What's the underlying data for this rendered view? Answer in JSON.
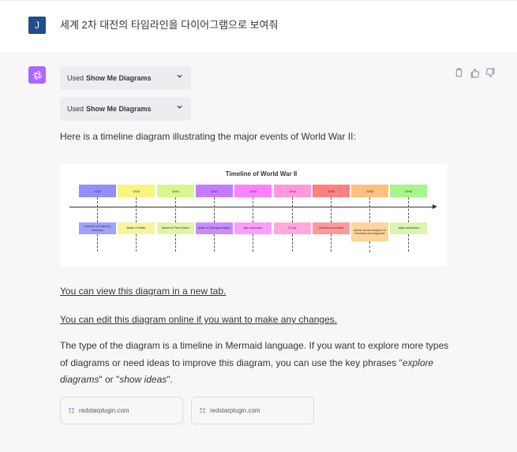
{
  "user": {
    "avatar_letter": "J",
    "message": "세계 2차 대전의 타임라인을 다이어그램으로 보여줘"
  },
  "plugins": [
    {
      "prefix": "Used",
      "name": "Show Me Diagrams"
    },
    {
      "prefix": "Used",
      "name": "Show Me Diagrams"
    }
  ],
  "intro": "Here is a timeline diagram illustrating the major events of World War II:",
  "diagram": {
    "title": "Timeline of World War II",
    "years": [
      {
        "label": "1939",
        "color": "#8f8fff"
      },
      {
        "label": "1940",
        "color": "#f5f580"
      },
      {
        "label": "1941",
        "color": "#d9f58c"
      },
      {
        "label": "1942",
        "color": "#c57bff"
      },
      {
        "label": "1943",
        "color": "#fc80ff"
      },
      {
        "label": "1944",
        "color": "#ff99d9"
      },
      {
        "label": "1945",
        "color": "#ff8080"
      },
      {
        "label": "1945",
        "color": "#ffc07f"
      },
      {
        "label": "1945",
        "color": "#a8f58c"
      }
    ],
    "events": [
      {
        "label": "Invasion of Poland by Germany",
        "color": "#a0a0ff"
      },
      {
        "label": "Battle of Britain",
        "color": "#f5f5a0"
      },
      {
        "label": "Attack on Pearl Harbor",
        "color": "#e1f5a8"
      },
      {
        "label": "Battle of Stalingrad begins",
        "color": "#c98cff"
      },
      {
        "label": "Italy surrenders",
        "color": "#fc9cff"
      },
      {
        "label": "D-Day",
        "color": "#ffa8dd"
      },
      {
        "label": "Germany surrenders",
        "color": "#ff9999"
      },
      {
        "label": "Atomic bombs dropped on Hiroshima and Nagasaki",
        "color": "#ffd699"
      },
      {
        "label": "Japan surrenders",
        "color": "#d9f5b0"
      }
    ]
  },
  "links": {
    "view": "You can view this diagram in a new tab.",
    "edit": "You can edit this diagram online if you want to make any changes."
  },
  "paragraph": {
    "part1": "The type of the diagram is a timeline in Mermaid language. If you want to explore more types of diagrams or need ideas to improve this diagram, you can use the key phrases \"",
    "em1": "explore diagrams",
    "part2": "\" or \"",
    "em2": "show ideas",
    "part3": "\"."
  },
  "sources": [
    {
      "label": "redstarplugin.com"
    },
    {
      "label": "redstarplugin.com"
    }
  ],
  "actions": [
    "copy-icon",
    "thumbs-up-icon",
    "thumbs-down-icon"
  ]
}
